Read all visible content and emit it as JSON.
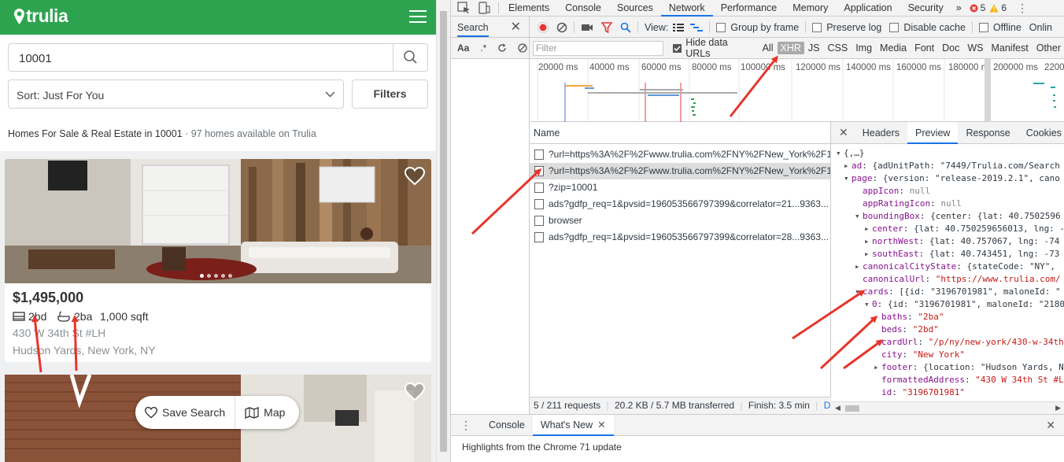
{
  "trulia": {
    "logo": "trulia",
    "search_value": "10001",
    "sort_label": "Sort: Just For You",
    "filters_label": "Filters",
    "heading": "Homes For Sale & Real Estate in 10001",
    "heading_count": " · 97 homes available on Trulia",
    "listing": {
      "price": "$1,495,000",
      "beds": "2bd",
      "baths": "2ba",
      "sqft": "1,000 sqft",
      "address": "430 W 34th St #LH",
      "city": "Hudson Yards, New York, NY"
    },
    "save_search_label": "Save Search",
    "map_label": "Map"
  },
  "devtools": {
    "tabs": [
      "Elements",
      "Console",
      "Sources",
      "Network",
      "Performance",
      "Memory",
      "Application",
      "Security",
      "»"
    ],
    "active_tab": "Network",
    "errors": "5",
    "warnings": "6",
    "search_panel_title": "Search",
    "toolbar": {
      "view_label": "View:",
      "group_by_frame": "Group by frame",
      "preserve_log": "Preserve log",
      "disable_cache": "Disable cache",
      "offline": "Offline",
      "online": "Onlin"
    },
    "filter_placeholder": "Filter",
    "hide_data_urls": "Hide data URLs",
    "filter_types": [
      "All",
      "XHR",
      "JS",
      "CSS",
      "Img",
      "Media",
      "Font",
      "Doc",
      "WS",
      "Manifest",
      "Other"
    ],
    "timeline_labels": [
      "20000 ms",
      "40000 ms",
      "60000 ms",
      "80000 ms",
      "100000 ms",
      "120000 ms",
      "140000 ms",
      "160000 ms",
      "180000 m",
      "200000 ms",
      "2200"
    ],
    "name_header": "Name",
    "requests": [
      "?url=https%3A%2F%2Fwww.trulia.com%2FNY%2FNew_York%2F1...",
      "?url=https%3A%2F%2Fwww.trulia.com%2FNY%2FNew_York%2F1...",
      "?zip=10001",
      "ads?gdfp_req=1&pvsid=196053566797399&correlator=21...9363...",
      "browser",
      "ads?gdfp_req=1&pvsid=196053566797399&correlator=28...9363..."
    ],
    "status": {
      "requests": "5 / 211 requests",
      "transferred": "20.2 KB / 5.7 MB transferred",
      "finish": "Finish: 3.5 min",
      "dom": "D..."
    },
    "detail_tabs": [
      "Headers",
      "Preview",
      "Response",
      "Cookies",
      "»"
    ],
    "active_detail_tab": "Preview",
    "preview": {
      "root": "{,…}",
      "ad_key": "ad",
      "ad_val": "{adUnitPath: \"7449/Trulia.com/Search",
      "page_key": "page",
      "page_val": "{version: \"release-2019.2.1\", cano",
      "appIcon_key": "appIcon",
      "appIcon_val": "null",
      "appRatingIcon_key": "appRatingIcon",
      "appRatingIcon_val": "null",
      "boundingBox_key": "boundingBox",
      "boundingBox_val": "{center: {lat: 40.7502596",
      "center_key": "center",
      "center_val": "{lat: 40.750259656013, lng: -",
      "northWest_key": "northWest",
      "northWest_val": "{lat: 40.757067, lng: -74",
      "southEast_key": "southEast",
      "southEast_val": "{lat: 40.743451, lng: -73",
      "canonicalCityState_key": "canonicalCityState",
      "canonicalCityState_val": "{stateCode: \"NY\",",
      "canonicalUrl_key": "canonicalUrl",
      "canonicalUrl_val": "\"https://www.trulia.com/",
      "cards_key": "cards",
      "cards_val": "[{id: \"3196701981\", maloneId: \"",
      "card0_key": "0",
      "card0_val": "{id: \"3196701981\", maloneId: \"2180",
      "baths_key": "baths",
      "baths_val": "\"2ba\"",
      "beds_key": "beds",
      "beds_val": "\"2bd\"",
      "cardUrl_key": "cardUrl",
      "cardUrl_val": "\"/p/ny/new-york/430-w-34th",
      "city_key": "city",
      "city_val": "\"New York\"",
      "footer_key": "footer",
      "footer_val": "{location: \"Hudson Yards, N",
      "formattedAddress_key": "formattedAddress",
      "formattedAddress_val": "\"430 W 34th St #L",
      "id_key": "id",
      "id_val": "\"3196701981\""
    },
    "drawer_tabs": [
      "Console",
      "What's New"
    ],
    "drawer_active": "What's New",
    "drawer_message": "Highlights from the Chrome 71 update"
  },
  "colors": {
    "trulia_green": "#2ea34f",
    "devtools_blue": "#1a73e8",
    "annotation_red": "#e8352b"
  }
}
